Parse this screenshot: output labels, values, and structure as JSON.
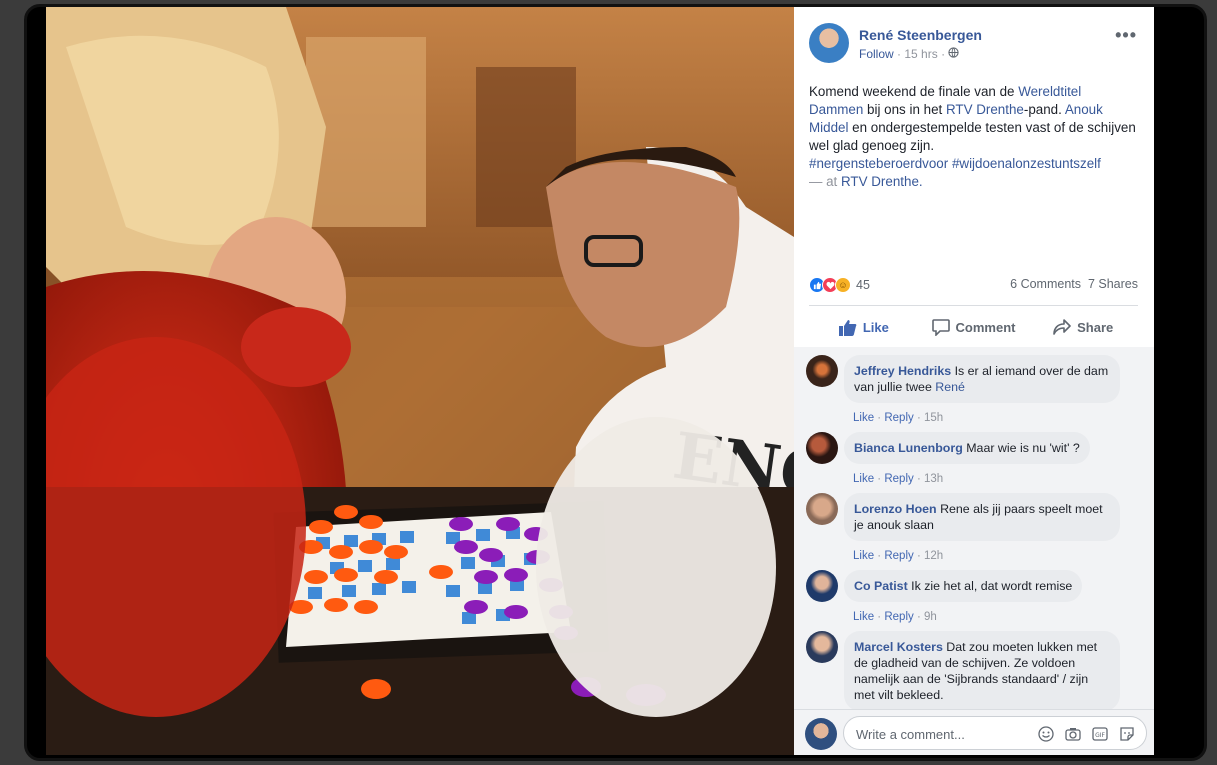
{
  "post": {
    "author": "René Steenbergen",
    "follow": "Follow",
    "time": "15 hrs",
    "privacy_icon": "globe-icon",
    "text": {
      "t1": "Komend weekend de finale van de ",
      "l1": "Wereldtitel Dammen",
      "t2": " bij ons in het ",
      "l2": "RTV Drenthe",
      "t3": "-pand. ",
      "l3": "Anouk Middel",
      "t4": " en ondergestempelde testen vast of de schijven wel glad genoeg zijn.",
      "h1": "#nergensteberoerdvoor",
      "h2": "#wijdoenalonzestuntszelf",
      "t5": "— at ",
      "l4": "RTV Drenthe",
      "t6": "."
    },
    "reaction_count": "45",
    "comments_count": "6 Comments",
    "shares_count": "7 Shares"
  },
  "actions": {
    "like": "Like",
    "comment": "Comment",
    "share": "Share"
  },
  "comments": [
    {
      "name": "Jeffrey Hendriks",
      "text": "Is er al iemand over de dam van jullie twee ",
      "mention": "René",
      "like": "Like",
      "reply": "Reply",
      "time": "15h"
    },
    {
      "name": "Bianca Lunenborg",
      "text": "Maar wie is nu 'wit' ?",
      "like": "Like",
      "reply": "Reply",
      "time": "13h"
    },
    {
      "name": "Lorenzo Hoen",
      "text": "Rene als jij paars speelt moet je anouk slaan",
      "like": "Like",
      "reply": "Reply",
      "time": "12h"
    },
    {
      "name": "Co Patist",
      "text": "Ik zie het al, dat wordt remise",
      "like": "Like",
      "reply": "Reply",
      "time": "9h"
    },
    {
      "name": "Marcel Kosters",
      "text": "Dat zou moeten lukken met de gladheid van de schijven. Ze voldoen namelijk aan de 'Sijbrands standaard' / zijn met vilt bekleed."
    }
  ],
  "composer": {
    "placeholder": "Write a comment..."
  },
  "colors": {
    "link": "#385898",
    "action_blue": "#4267b2",
    "bubble": "#e9ebee"
  }
}
